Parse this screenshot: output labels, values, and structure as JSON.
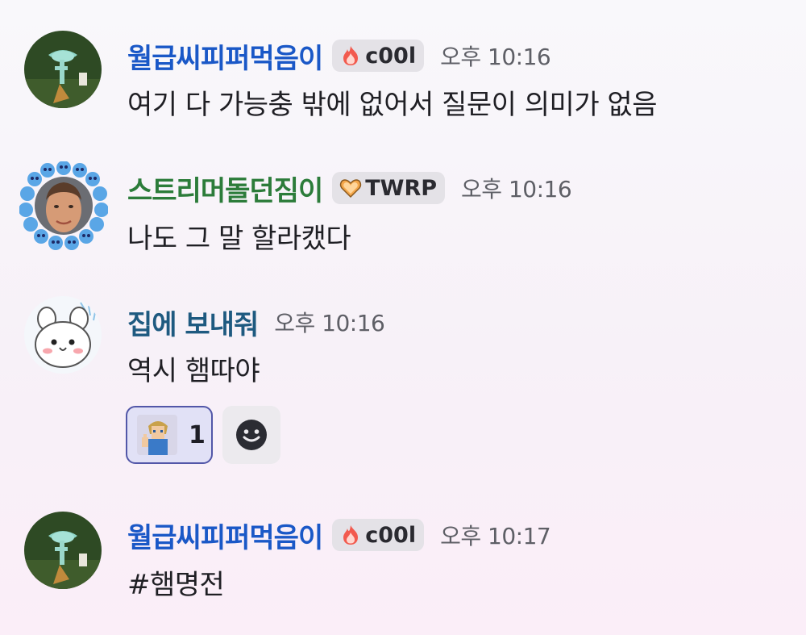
{
  "colors": {
    "username_blue": "#1a58c7",
    "username_green": "#2c7c3a",
    "username_teal": "#1e5a80",
    "timestamp": "#5e5f66",
    "reaction_border": "#5257a8",
    "reaction_bg": "#e1e1f6"
  },
  "messages": [
    {
      "username": "월급씨피퍼먹음이",
      "tag": "c00l",
      "tag_icon": "flame-icon",
      "timestamp": "오후 10:16",
      "content": "여기 다 가능충 밖에 없어서 질문이 의미가 없음"
    },
    {
      "username": "스트리머돌던짐이",
      "tag": "TWRP",
      "tag_icon": "heart-icon",
      "timestamp": "오후 10:16",
      "content": "나도 그 말 할라캤다"
    },
    {
      "username": "집에 보내줘",
      "timestamp": "오후 10:16",
      "content": "역시 햄따야",
      "reaction": {
        "emoji": "link-thumbs-up-emoji",
        "count": "1"
      }
    },
    {
      "username": "월급씨피퍼먹음이",
      "tag": "c00l",
      "tag_icon": "flame-icon",
      "timestamp": "오후 10:17",
      "content": "#햄명전"
    }
  ]
}
